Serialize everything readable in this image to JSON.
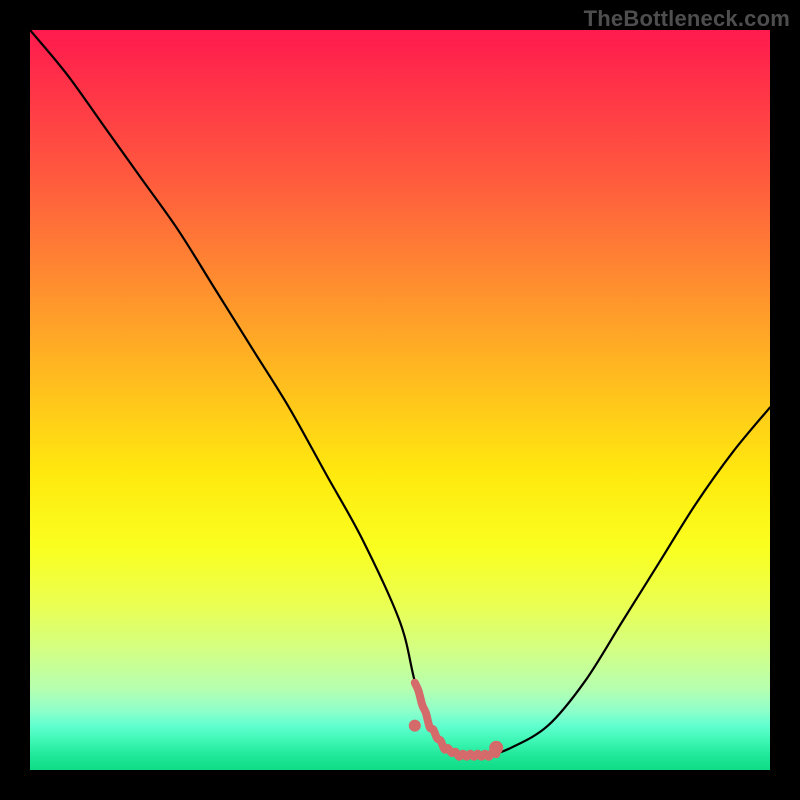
{
  "watermark": "TheBottleneck.com",
  "colors": {
    "frame_bg": "#000000",
    "curve": "#000000",
    "highlight": "#d46a6a"
  },
  "chart_data": {
    "type": "line",
    "title": "",
    "xlabel": "",
    "ylabel": "",
    "xlim": [
      0,
      100
    ],
    "ylim": [
      0,
      100
    ],
    "grid": false,
    "series": [
      {
        "name": "curve",
        "x": [
          0,
          5,
          10,
          15,
          20,
          25,
          30,
          35,
          40,
          45,
          50,
          52,
          54,
          56,
          58,
          60,
          62,
          65,
          70,
          75,
          80,
          85,
          90,
          95,
          100
        ],
        "y": [
          100,
          94,
          87,
          80,
          73,
          65,
          57,
          49,
          40,
          31,
          20,
          12,
          6,
          3,
          2,
          2,
          2,
          3,
          6,
          12,
          20,
          28,
          36,
          43,
          49
        ]
      }
    ],
    "highlight_range": {
      "x_start": 52,
      "x_end": 63
    },
    "dots": [
      {
        "x": 52,
        "y": 6
      },
      {
        "x": 63,
        "y": 3
      }
    ],
    "annotations": []
  }
}
